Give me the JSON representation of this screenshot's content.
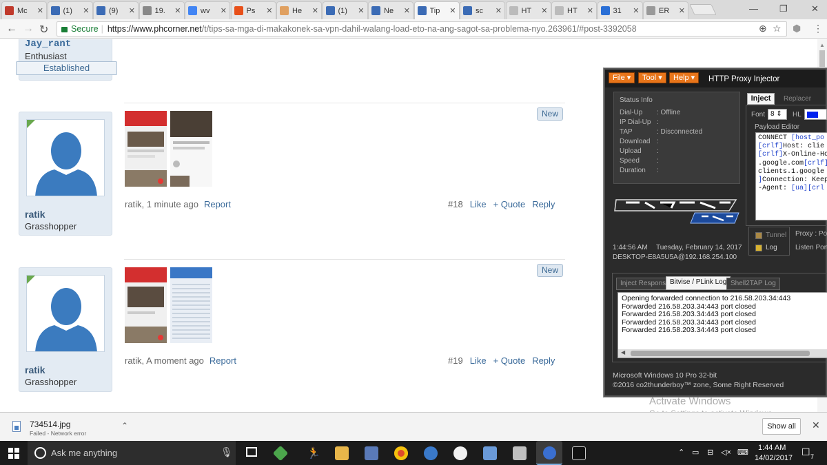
{
  "browser": {
    "tabs": [
      {
        "label": "Mc",
        "color": "#c0392b"
      },
      {
        "label": "(1)",
        "color": "#3b6bb5"
      },
      {
        "label": "(9)",
        "color": "#3b6bb5"
      },
      {
        "label": "19.",
        "color": "#888888"
      },
      {
        "label": "wv",
        "color": "#4285f4"
      },
      {
        "label": "Ps",
        "color": "#e8501a"
      },
      {
        "label": "He",
        "color": "#e0a060"
      },
      {
        "label": "(1)",
        "color": "#3b6bb5"
      },
      {
        "label": "Ne",
        "color": "#3b6bb5"
      },
      {
        "label": "Tip",
        "color": "#3b6bb5"
      },
      {
        "label": "sc",
        "color": "#3b6bb5"
      },
      {
        "label": "HT",
        "color": "#bbbbbb"
      },
      {
        "label": "HT",
        "color": "#bbbbbb"
      },
      {
        "label": "31",
        "color": "#2a6fd6"
      },
      {
        "label": "ER",
        "color": "#999999"
      }
    ],
    "active_tab_index": 9,
    "address": {
      "secure_label": "Secure",
      "host": "https://www.phcorner.net",
      "path": "/t/tips-sa-mga-di-makakonek-sa-vpn-dahil-walang-load-eto-na-ang-sagot-sa-problema-nyo.263961/#post-3392058"
    }
  },
  "forum": {
    "prev_user": {
      "name": "Jay_rant",
      "title": "Enthusiast",
      "badge": "Established"
    },
    "posts": [
      {
        "user": "ratik",
        "rank": "Grasshopper",
        "badge": "New",
        "author_time": "ratik, 1 minute ago",
        "report": "Report",
        "number": "#18",
        "like": "Like",
        "quote": "+ Quote",
        "reply": "Reply"
      },
      {
        "user": "ratik",
        "rank": "Grasshopper",
        "badge": "New",
        "author_time": "ratik, A moment ago",
        "report": "Report",
        "number": "#19",
        "like": "Like",
        "quote": "+ Quote",
        "reply": "Reply"
      }
    ]
  },
  "proxy_app": {
    "menus": [
      "File",
      "Tool",
      "Help"
    ],
    "title": "HTTP Proxy Injector",
    "status_title": "Status Info",
    "status": [
      {
        "label": "Dial-Up",
        "value": ": Offline"
      },
      {
        "label": "IP Dial-Up",
        "value": ":"
      },
      {
        "label": "TAP",
        "value": ": Disconnected"
      },
      {
        "label": "Download",
        "value": ":"
      },
      {
        "label": "Upload",
        "value": ":"
      },
      {
        "label": "Speed",
        "value": ":"
      },
      {
        "label": "Duration",
        "value": ":"
      }
    ],
    "time": "1:44:56 AM",
    "date": "Tuesday, February 14, 2017",
    "host": "DESKTOP-E8A5U5A@192.168.254.100",
    "tabs": [
      "Inject",
      "Replacer"
    ],
    "font_label": "Font",
    "font_value": "8",
    "hl_label": "HL",
    "payload_title": "Payload Editor",
    "payload_lines": [
      {
        "a": "CONNECT ",
        "b": "[host_po"
      },
      {
        "a": "",
        "b": "[crlf]",
        "c": "Host: clie"
      },
      {
        "a": "",
        "b": "[crlf]",
        "c": "X-Online-Ho"
      },
      {
        "a": ".google.com",
        "b": "[crlf]"
      },
      {
        "a": " clients.1.google",
        "b": ""
      },
      {
        "a": "",
        "b": "]",
        "c": "Connection: Keep"
      },
      {
        "a": "-Agent: ",
        "b": "[ua][crl"
      }
    ],
    "tunnel_label": "Tunnel",
    "log_label": "Log",
    "proxy_label": "Proxy : Por",
    "listen_label": "Listen Port",
    "log_tabs": [
      "Inject Respons",
      "Bitvise / PLink Log",
      "Shell2TAP Log"
    ],
    "log_lines": [
      "Opening forwarded connection to 216.58.203.34:443",
      "Forwarded 216.58.203.34:443 port closed",
      "Forwarded 216.58.203.34:443 port closed",
      "Forwarded 216.58.203.34:443 port closed",
      "Forwarded 216.58.203.34:443 port closed"
    ],
    "os_line": "Microsoft Windows 10 Pro 32-bit",
    "copyright": "©2016 co2thunderboy™ zone, Some Right Reserved"
  },
  "watermark": {
    "line1": "Activate Windows",
    "line2": "Go to Settings to activate Windows."
  },
  "download": {
    "filename": "734514.jpg",
    "status": "Failed - Network error",
    "show_all": "Show all"
  },
  "taskbar": {
    "search_placeholder": "Ask me anything",
    "time": "1:44 AM",
    "date": "14/02/2017",
    "notif_count": "7"
  }
}
